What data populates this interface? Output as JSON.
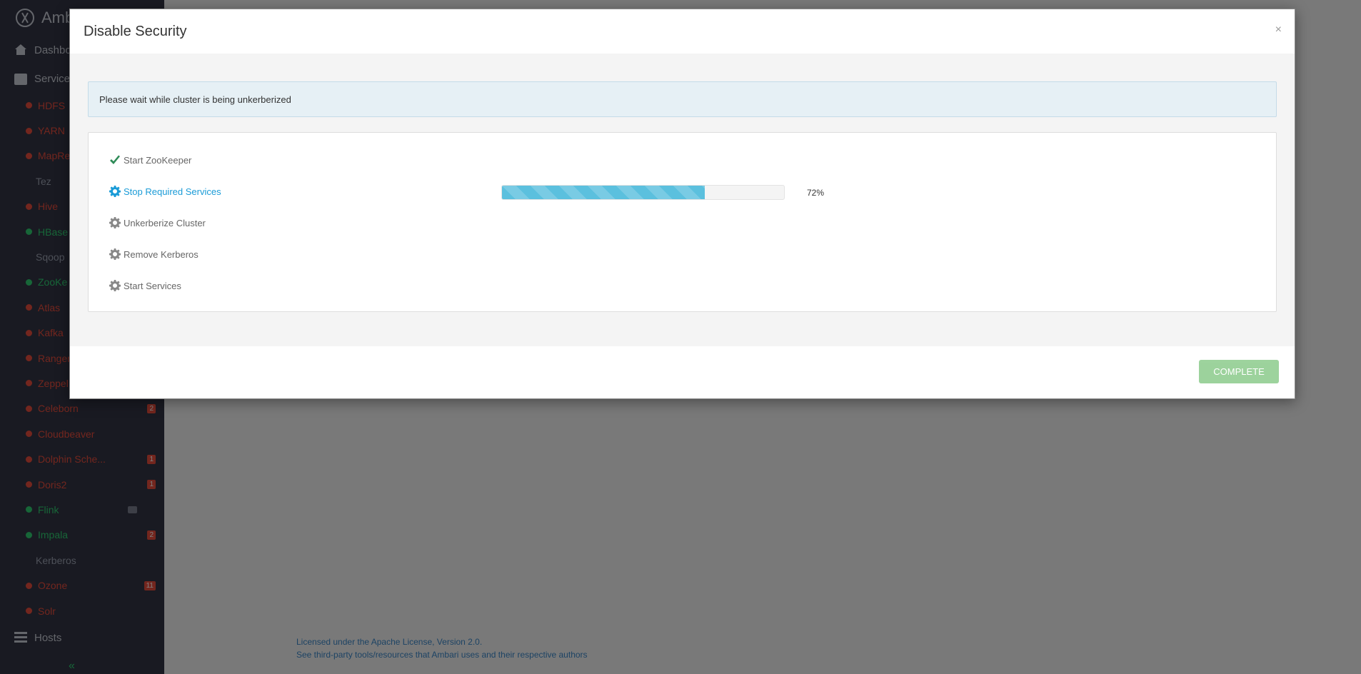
{
  "app": {
    "brand": "Amb"
  },
  "sidebar": {
    "dashboard_label": "Dashbo",
    "services_label": "Services",
    "hosts_label": "Hosts",
    "services": [
      {
        "label": "HDFS",
        "status": "red",
        "badge": ""
      },
      {
        "label": "YARN",
        "status": "red",
        "badge": ""
      },
      {
        "label": "MapRe",
        "status": "red",
        "badge": ""
      },
      {
        "label": "Tez",
        "status": "none",
        "badge": ""
      },
      {
        "label": "Hive",
        "status": "red",
        "badge": ""
      },
      {
        "label": "HBase",
        "status": "green",
        "badge": ""
      },
      {
        "label": "Sqoop",
        "status": "none",
        "badge": ""
      },
      {
        "label": "ZooKe",
        "status": "green",
        "badge": ""
      },
      {
        "label": "Atlas",
        "status": "red",
        "badge": ""
      },
      {
        "label": "Kafka",
        "status": "red",
        "badge": ""
      },
      {
        "label": "Ranger",
        "status": "red",
        "badge": ""
      },
      {
        "label": "Zeppel",
        "status": "red",
        "badge": ""
      },
      {
        "label": "Celeborn",
        "status": "red",
        "badge": "2"
      },
      {
        "label": "Cloudbeaver",
        "status": "red",
        "badge": ""
      },
      {
        "label": "Dolphin Sche...",
        "status": "red",
        "badge": "1"
      },
      {
        "label": "Doris2",
        "status": "red",
        "badge": "1"
      },
      {
        "label": "Flink",
        "status": "green",
        "badge": ""
      },
      {
        "label": "Impala",
        "status": "green",
        "badge": "2"
      },
      {
        "label": "Kerberos",
        "status": "none",
        "badge": ""
      },
      {
        "label": "Ozone",
        "status": "red",
        "badge": "11"
      },
      {
        "label": "Solr",
        "status": "red",
        "badge": ""
      }
    ]
  },
  "footer": {
    "license": "Licensed under the Apache License, Version 2.0.",
    "third_party": "See third-party tools/resources that Ambari uses and their respective authors"
  },
  "modal": {
    "title": "Disable Security",
    "close": "×",
    "alert": "Please wait while cluster is being unkerberized",
    "steps": [
      {
        "label": "Start ZooKeeper",
        "state": "done"
      },
      {
        "label": "Stop Required Services",
        "state": "active"
      },
      {
        "label": "Unkerberize Cluster",
        "state": "pending"
      },
      {
        "label": "Remove Kerberos",
        "state": "pending"
      },
      {
        "label": "Start Services",
        "state": "pending"
      }
    ],
    "progress": {
      "value": 0.72,
      "label": "72%"
    },
    "complete_button": "COMPLETE"
  },
  "colors": {
    "active": "#1a9bd7",
    "done": "#2e8b57",
    "pending": "#888888",
    "progress": "#5bc0de"
  }
}
